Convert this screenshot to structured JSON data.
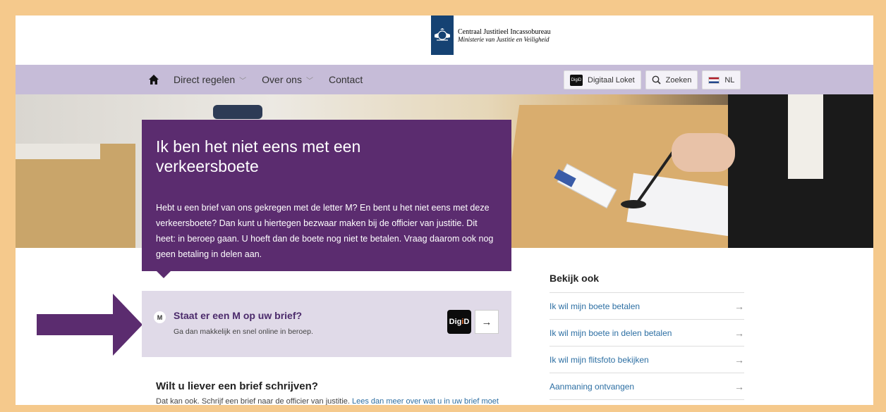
{
  "header": {
    "org_name": "Centraal Justitieel Incassobureau",
    "ministry": "Ministerie van Justitie en Veiligheid"
  },
  "nav": {
    "items": [
      {
        "label": "Direct regelen",
        "has_dropdown": true
      },
      {
        "label": "Over ons",
        "has_dropdown": true
      },
      {
        "label": "Contact",
        "has_dropdown": false
      }
    ],
    "digitaal_loket": "Digitaal Loket",
    "digid_mini": "DigiD",
    "search": "Zoeken",
    "language": "NL"
  },
  "intro": {
    "title": "Ik ben het niet eens met een verkeersboete",
    "body": "Hebt u een brief van ons gekregen met de letter M? En bent u het niet eens met deze verkeersboete? Dan kunt u hiertegen bezwaar maken bij de officier van justitie. Dit heet: in beroep gaan. U hoeft dan de boete nog niet te betalen. Vraag daarom ook nog geen betaling in delen aan."
  },
  "m_card": {
    "badge": "M",
    "title": "Staat er een M op uw brief?",
    "subtitle": "Ga dan makkelijk en snel online in beroep.",
    "digid_prefix": "Dig",
    "digid_i": "i",
    "digid_suffix": "D",
    "arrow": "→"
  },
  "letter": {
    "heading": "Wilt u liever een brief schrijven?",
    "text": "Dat kan ook. Schrijf een brief naar de officier van justitie.",
    "link": "Lees dan meer over wat u in uw brief moet"
  },
  "side": {
    "heading": "Bekijk ook",
    "items": [
      "Ik wil mijn boete betalen",
      "Ik wil mijn boete in delen betalen",
      "Ik wil mijn flitsfoto bekijken",
      "Aanmaning ontvangen"
    ],
    "arrow": "→"
  },
  "colors": {
    "frame": "#f5c98c",
    "nav": "#c6bcd8",
    "intro": "#5b2c6f",
    "card": "#e0dae8",
    "link": "#2d6fa3",
    "annotation_arrow": "#5b2c6f"
  }
}
